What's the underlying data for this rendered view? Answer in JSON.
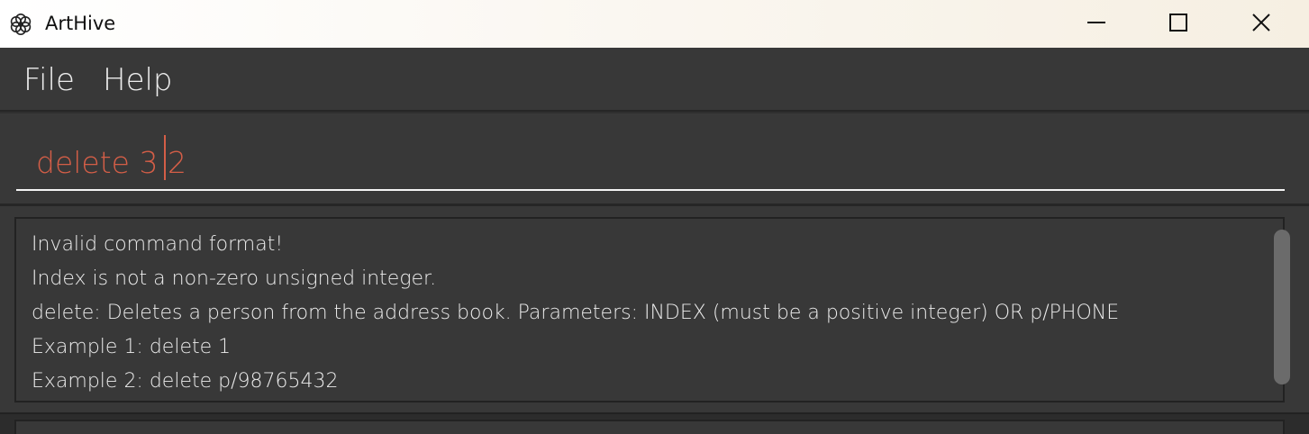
{
  "window": {
    "title": "ArtHive",
    "icon": "flower-icon",
    "controls": [
      "minimize-icon",
      "maximize-icon",
      "close-icon"
    ]
  },
  "menu": {
    "items": [
      {
        "label": "File"
      },
      {
        "label": "Help"
      }
    ]
  },
  "command": {
    "value": "delete 3 2",
    "text_color": "#d45e47"
  },
  "result": {
    "lines": [
      "Invalid command format!",
      "Index is not a non-zero unsigned integer.",
      "delete: Deletes a person from the address book. Parameters: INDEX (must be a positive integer) OR p/PHONE",
      "Example 1: delete 1",
      "Example 2: delete p/98765432"
    ]
  },
  "colors": {
    "background": "#383838",
    "text": "#ececec",
    "accent": "#d45e47"
  }
}
